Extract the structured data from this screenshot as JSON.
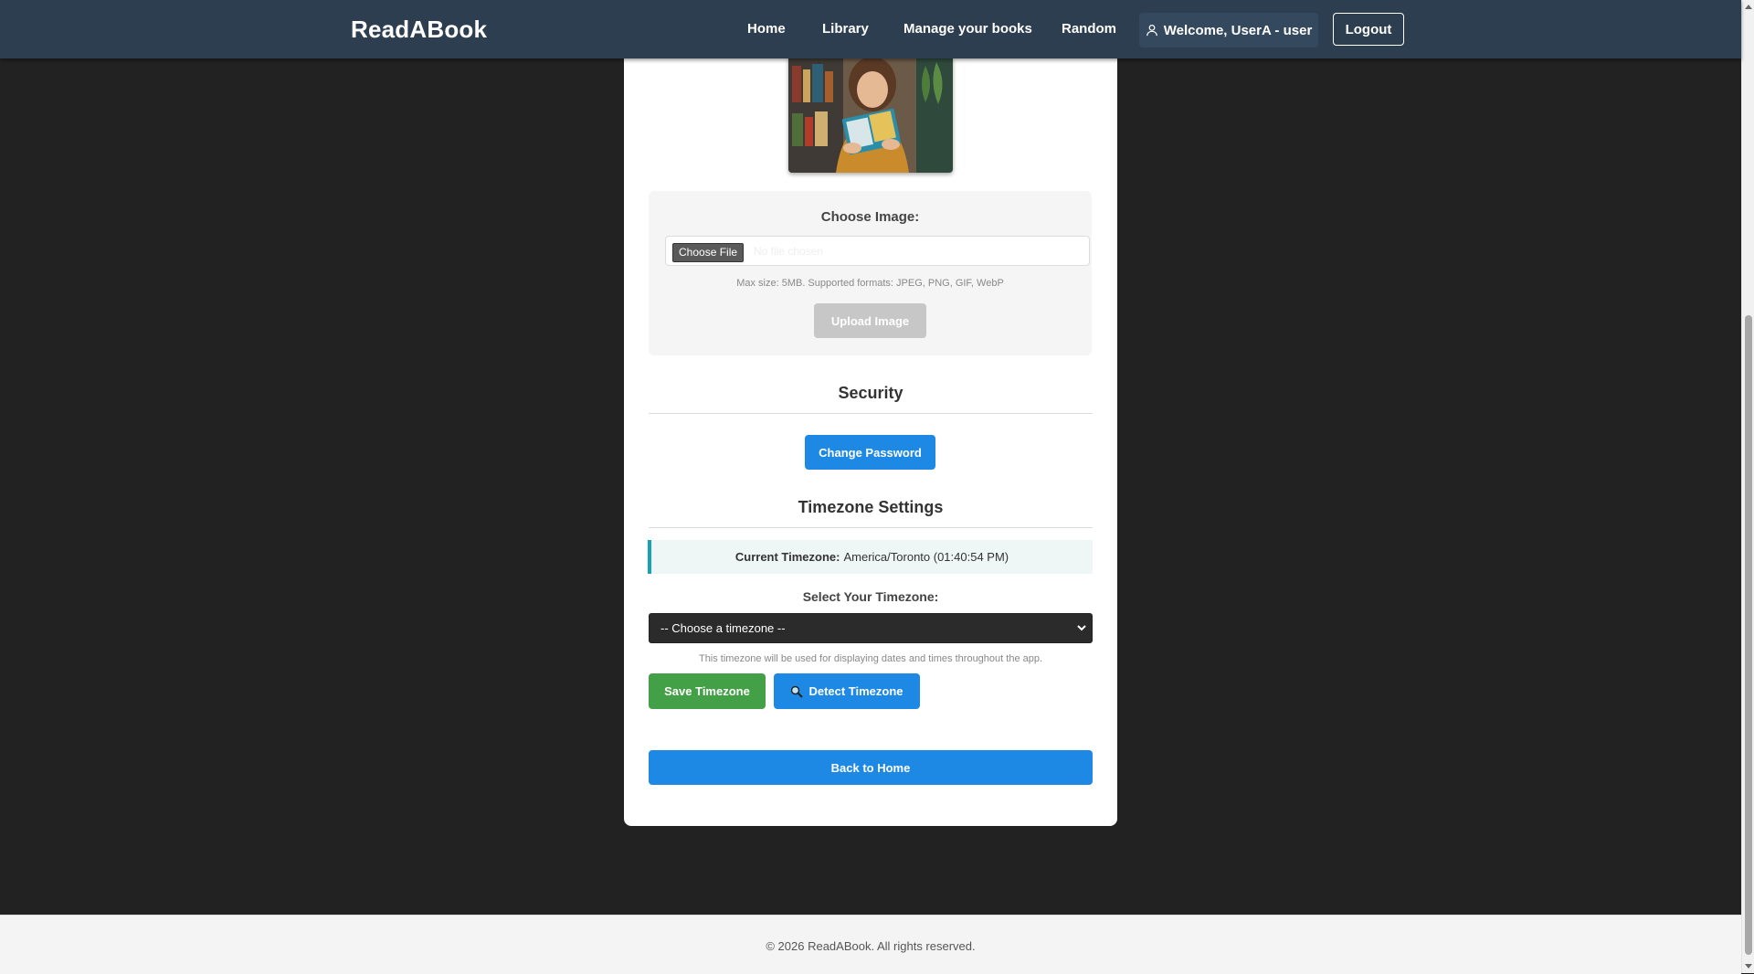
{
  "navbar": {
    "brand": "ReadABook",
    "links": [
      "Home",
      "Library",
      "Manage your books",
      "Random"
    ],
    "welcome": "Welcome, UserA - user",
    "logout": "Logout"
  },
  "profile": {
    "image_alt": "profile-photo-woman-reading-book"
  },
  "upload": {
    "label": "Choose Image:",
    "file_button": "Choose File",
    "file_status": "No file chosen",
    "hint": "Max size: 5MB. Supported formats: JPEG, PNG, GIF, WebP",
    "upload_button": "Upload Image"
  },
  "security": {
    "title": "Security",
    "change_password": "Change Password"
  },
  "timezone": {
    "title": "Timezone Settings",
    "current_label": "Current Timezone:",
    "current_value": "America/Toronto (01:40:54 PM)",
    "select_label": "Select Your Timezone:",
    "select_value": "-- Choose a timezone --",
    "hint": "This timezone will be used for displaying dates and times throughout the app.",
    "save_button": "Save Timezone",
    "detect_button": "Detect Timezone"
  },
  "back_home": "Back to Home",
  "footer": "© 2026 ReadABook. All rights reserved.",
  "colors": {
    "navbar_bg": "#2c3e50",
    "page_bg": "#222222",
    "primary_blue": "#1e88e5",
    "success_green": "#43a047",
    "info_border": "#17a2b8"
  }
}
